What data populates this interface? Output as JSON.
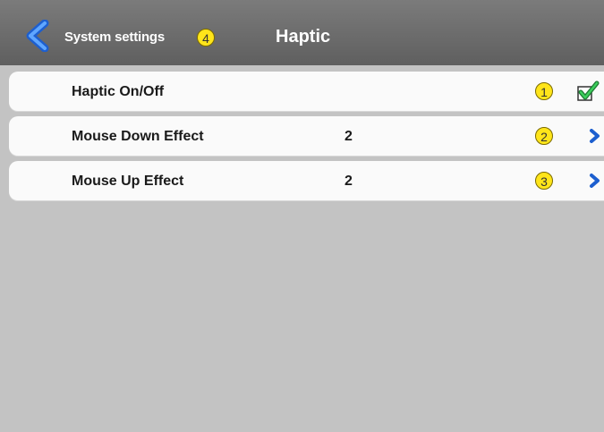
{
  "header": {
    "back_label": "System settings",
    "back_badge": "4",
    "title": "Haptic"
  },
  "rows": [
    {
      "label": "Haptic On/Off",
      "value": "",
      "badge": "1",
      "control": "check-icon",
      "checked": true
    },
    {
      "label": "Mouse Down Effect",
      "value": "2",
      "badge": "2",
      "control": "chevron-right-icon"
    },
    {
      "label": "Mouse Up Effect",
      "value": "2",
      "badge": "3",
      "control": "chevron-right-icon"
    }
  ],
  "colors": {
    "header": "#6a6a6a",
    "background": "#c3c3c3",
    "row": "#fafafa",
    "badge": "#ffe51a",
    "accent_blue": "#2a6fd8",
    "check_green": "#2aa84a"
  }
}
